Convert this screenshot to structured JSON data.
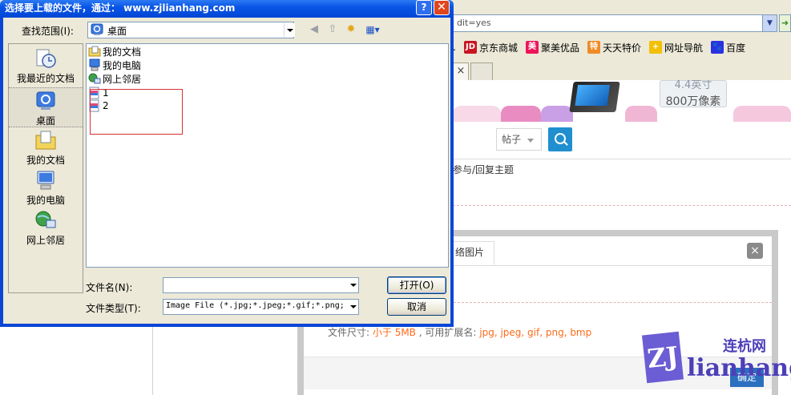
{
  "browser": {
    "address_text": "dit=yes",
    "favorites": [
      {
        "label": "京东商城",
        "icon": "jd-icon",
        "glyph": "JD",
        "color": "#c81623"
      },
      {
        "label": "聚美优品",
        "icon": "jumei-icon",
        "glyph": "美",
        "color": "#ed145b"
      },
      {
        "label": "天天特价",
        "icon": "tejia-icon",
        "glyph": "特",
        "color": "#f08a24"
      },
      {
        "label": "网址导航",
        "icon": "hao-nav-icon",
        "glyph": "+",
        "color": "#f2c000"
      },
      {
        "label": "百度",
        "icon": "baidu-paw-icon",
        "glyph": "🐾",
        "color": "#2932e1"
      }
    ],
    "tab_close_glyph": "×"
  },
  "page": {
    "camera_top": "4.4英寸",
    "camera_text": "800万像素",
    "search_scope": "帖子",
    "reply_topic_text": "参与/回复主题"
  },
  "upload_modal": {
    "tab_label": "络图片",
    "close_glyph": "×",
    "size_label": "文件尺寸:",
    "size_value": "小于 5MB",
    "ext_label": ", 可用扩展名:",
    "ext_value": "jpg, jpeg, gif, png, bmp",
    "confirm_label": "确定"
  },
  "watermark": {
    "badge": "ZJ",
    "site": "连杭网",
    "word": "lianhang"
  },
  "dialog": {
    "title": "选择要上载的文件，通过： www.zjlianhang.com",
    "help_glyph": "?",
    "close_glyph": "✕",
    "look_in_label": "查找范围(I):",
    "look_in_value": "桌面",
    "places": [
      {
        "label": "我最近的文档",
        "icon": "recent-documents-icon"
      },
      {
        "label": "桌面",
        "icon": "desktop-icon"
      },
      {
        "label": "我的文档",
        "icon": "my-documents-icon"
      },
      {
        "label": "我的电脑",
        "icon": "my-computer-icon"
      },
      {
        "label": "网上邻居",
        "icon": "network-places-icon"
      }
    ],
    "files": [
      {
        "name": "我的文档",
        "icon": "my-documents-icon"
      },
      {
        "name": "我的电脑",
        "icon": "my-computer-icon"
      },
      {
        "name": "网上邻居",
        "icon": "network-places-icon"
      },
      {
        "name": "1",
        "icon": "image-file-icon"
      },
      {
        "name": "2",
        "icon": "image-file-icon"
      }
    ],
    "filename_label": "文件名(N):",
    "filename_value": "",
    "filetype_label": "文件类型(T):",
    "filetype_value": "Image File (*.jpg;*.jpeg;*.gif;*.png;",
    "open_label": "打开(O)",
    "cancel_label": "取消"
  }
}
